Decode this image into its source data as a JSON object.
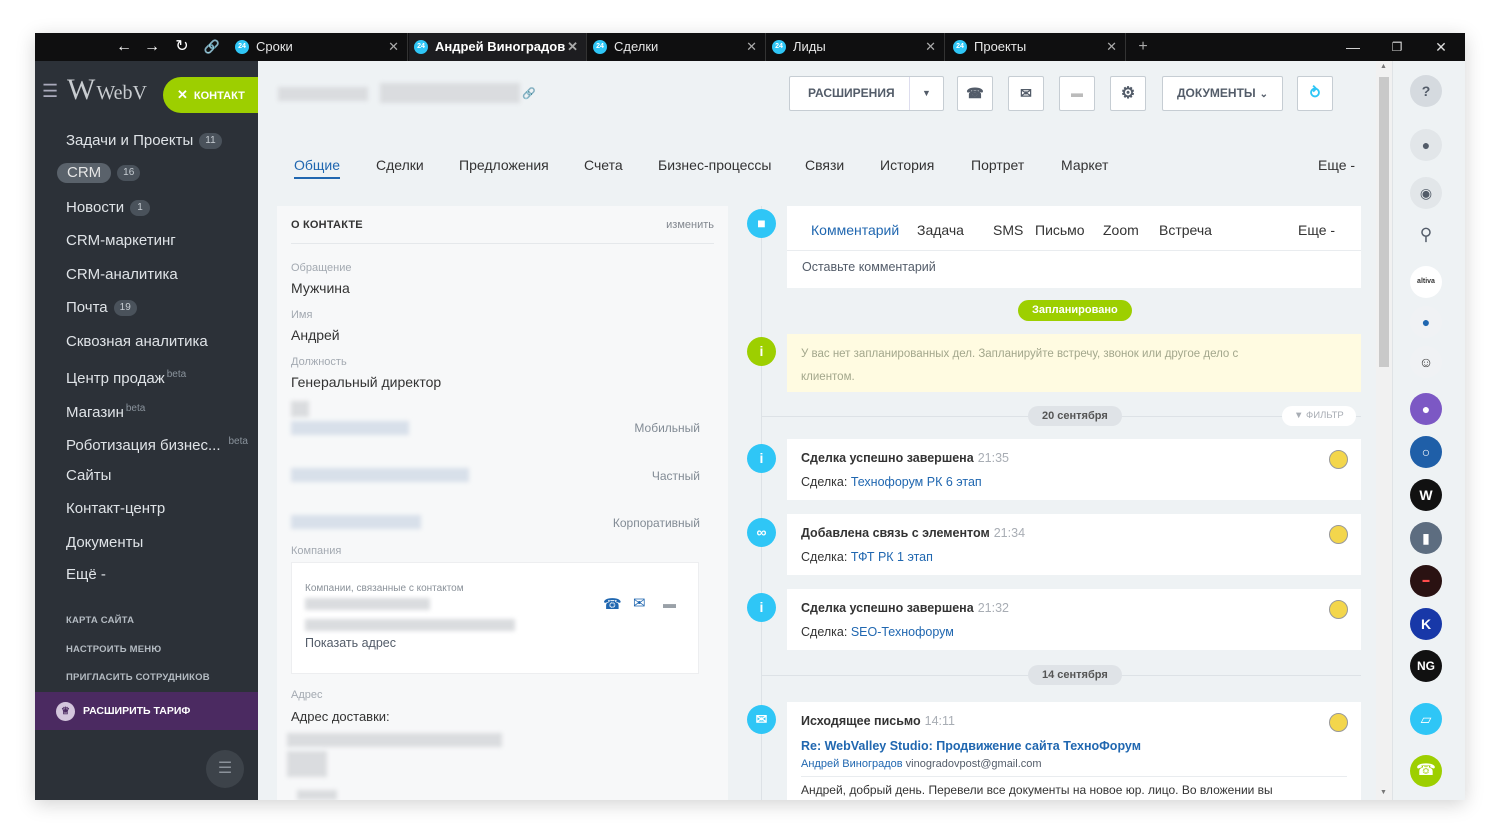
{
  "browser": {
    "tabs": [
      {
        "label": "Сроки",
        "active": false
      },
      {
        "label": "Андрей Виноградов",
        "active": true
      },
      {
        "label": "Сделки",
        "active": false
      },
      {
        "label": "Лиды",
        "active": false
      },
      {
        "label": "Проекты",
        "active": false
      }
    ],
    "tab_badge": "24",
    "new_tab": "+"
  },
  "sidebar": {
    "logo": "WebV",
    "contact_button": "КОНТАКТ",
    "items": [
      {
        "label": "Задачи и Проекты",
        "badge": "11"
      },
      {
        "label": "CRM",
        "badge": "16"
      },
      {
        "label": "Новости",
        "badge": "1"
      },
      {
        "label": "CRM-маркетинг"
      },
      {
        "label": "CRM-аналитика"
      },
      {
        "label": "Почта",
        "badge": "19"
      },
      {
        "label": "Сквозная аналитика"
      },
      {
        "label": "Центр продаж",
        "beta": "beta"
      },
      {
        "label": "Магазин",
        "beta": "beta"
      },
      {
        "label": "Роботизация бизнес...",
        "beta": "beta"
      },
      {
        "label": "Сайты"
      },
      {
        "label": "Контакт-центр"
      },
      {
        "label": "Документы"
      },
      {
        "label": "Ещё -"
      }
    ],
    "links": [
      "КАРТА САЙТА",
      "НАСТРОИТЬ МЕНЮ",
      "ПРИГЛАСИТЬ СОТРУДНИКОВ"
    ],
    "upgrade": "РАСШИРИТЬ ТАРИФ"
  },
  "header": {
    "extensions": "РАСШИРЕНИЯ",
    "documents": "ДОКУМЕНТЫ"
  },
  "content_tabs": [
    "Общие",
    "Сделки",
    "Предложения",
    "Счета",
    "Бизнес-процессы",
    "Связи",
    "История",
    "Портрет",
    "Маркет",
    "Еще -"
  ],
  "contact": {
    "section_title": "О КОНТАКТЕ",
    "edit": "изменить",
    "salutation_label": "Обращение",
    "salutation": "Мужчина",
    "name_label": "Имя",
    "name": "Андрей",
    "position_label": "Должность",
    "position": "Генеральный директор",
    "phone_types": [
      "Мобильный",
      "Частный",
      "Корпоративный"
    ],
    "company_label": "Компания",
    "company_box_title": "Компании, связанные с контактом",
    "show_address": "Показать адрес",
    "address_label": "Адрес",
    "delivery_address_label": "Адрес доставки:"
  },
  "activity": {
    "tabs": [
      "Комментарий",
      "Задача",
      "SMS",
      "Письмо",
      "Zoom",
      "Встреча",
      "Еще -"
    ],
    "comment_placeholder": "Оставьте комментарий",
    "planned_label": "Запланировано",
    "planned_note": "У вас нет запланированных дел. Запланируйте встречу, звонок или другое дело с клиентом.",
    "date1": "20 сентября",
    "filter": "ФИЛЬТР",
    "events": [
      {
        "title": "Сделка успешно завершена",
        "time": "21:35",
        "prefix": "Сделка:",
        "link": "Технофорум РК 6 этап"
      },
      {
        "title": "Добавлена связь с элементом",
        "time": "21:34",
        "prefix": "Сделка:",
        "link": "ТФТ РК 1 этап"
      },
      {
        "title": "Сделка успешно завершена",
        "time": "21:32",
        "prefix": "Сделка:",
        "link": "SEO-Технофорум"
      }
    ],
    "date2": "14 сентября",
    "email": {
      "title": "Исходящее письмо",
      "time": "14:11",
      "subject": "Re: WebValley Studio: Продвижение сайта ТехноФорум",
      "from_name": "Андрей Виноградов",
      "from_email": "vinogradovpost@gmail.com",
      "body": "Андрей, добрый день. Перевели все документы на новое юр. лицо. Во вложении вы"
    }
  },
  "right_bar": {
    "help": "?",
    "avatars": [
      "altiva",
      "",
      "",
      "",
      "",
      "W",
      "",
      "",
      "K",
      "NG"
    ]
  }
}
